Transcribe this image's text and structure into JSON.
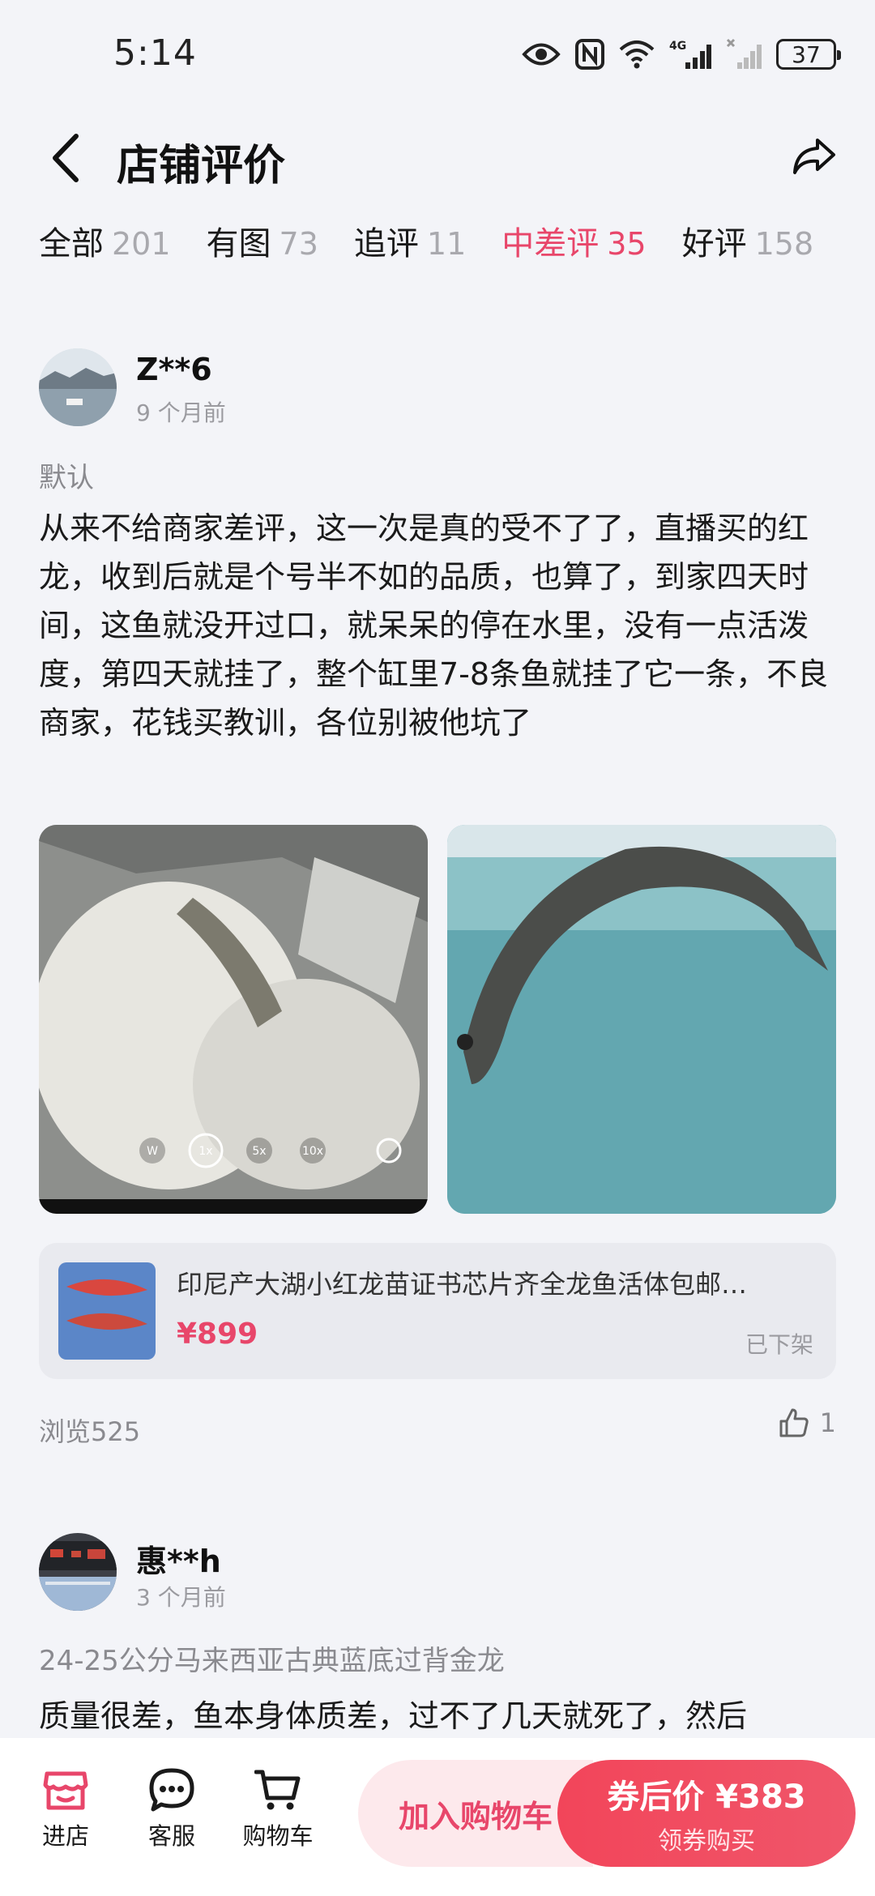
{
  "status_bar": {
    "time": "5:14",
    "battery": "37"
  },
  "header": {
    "title": "店铺评价"
  },
  "tabs": [
    {
      "label": "全部",
      "count": "201"
    },
    {
      "label": "有图",
      "count": "73"
    },
    {
      "label": "追评",
      "count": "11"
    },
    {
      "label": "中差评",
      "count": "35",
      "active": true
    },
    {
      "label": "好评",
      "count": "158"
    }
  ],
  "reviews": [
    {
      "username": "Z**6",
      "time_ago": "9 个月前",
      "spec": "默认",
      "content": "从来不给商家差评，这一次是真的受不了了，直播买的红龙，收到后就是个号半不如的品质，也算了，到家四天时间，这鱼就没开过口，就呆呆的停在水里，没有一点活泼度，第四天就挂了，整个缸里7-8条鱼就挂了它一条，不良商家，花钱买教训，各位别被他坑了",
      "camera_zoom_labels": [
        "W",
        "1x",
        "5x",
        "10x"
      ],
      "product": {
        "name": "印尼产大湖小红龙苗证书芯片齐全龙鱼活体包邮…",
        "price": "¥899",
        "status": "已下架"
      },
      "views": "浏览525",
      "likes": "1"
    },
    {
      "username": "惠**h",
      "time_ago": "3 个月前",
      "spec": "24-25公分马来西亚古典蓝底过背金龙",
      "content": "质量很差，鱼本身体质差，过不了几天就死了，然后"
    }
  ],
  "bottom_bar": {
    "store_label": "进店",
    "service_label": "客服",
    "cart_label": "购物车",
    "add_to_cart": "加入购物车",
    "buy_price": "券后价 ¥383",
    "buy_sub": "领券购买"
  },
  "colors": {
    "accent": "#e8466a",
    "background": "#f3f4f8",
    "card": "#e9eaef"
  }
}
